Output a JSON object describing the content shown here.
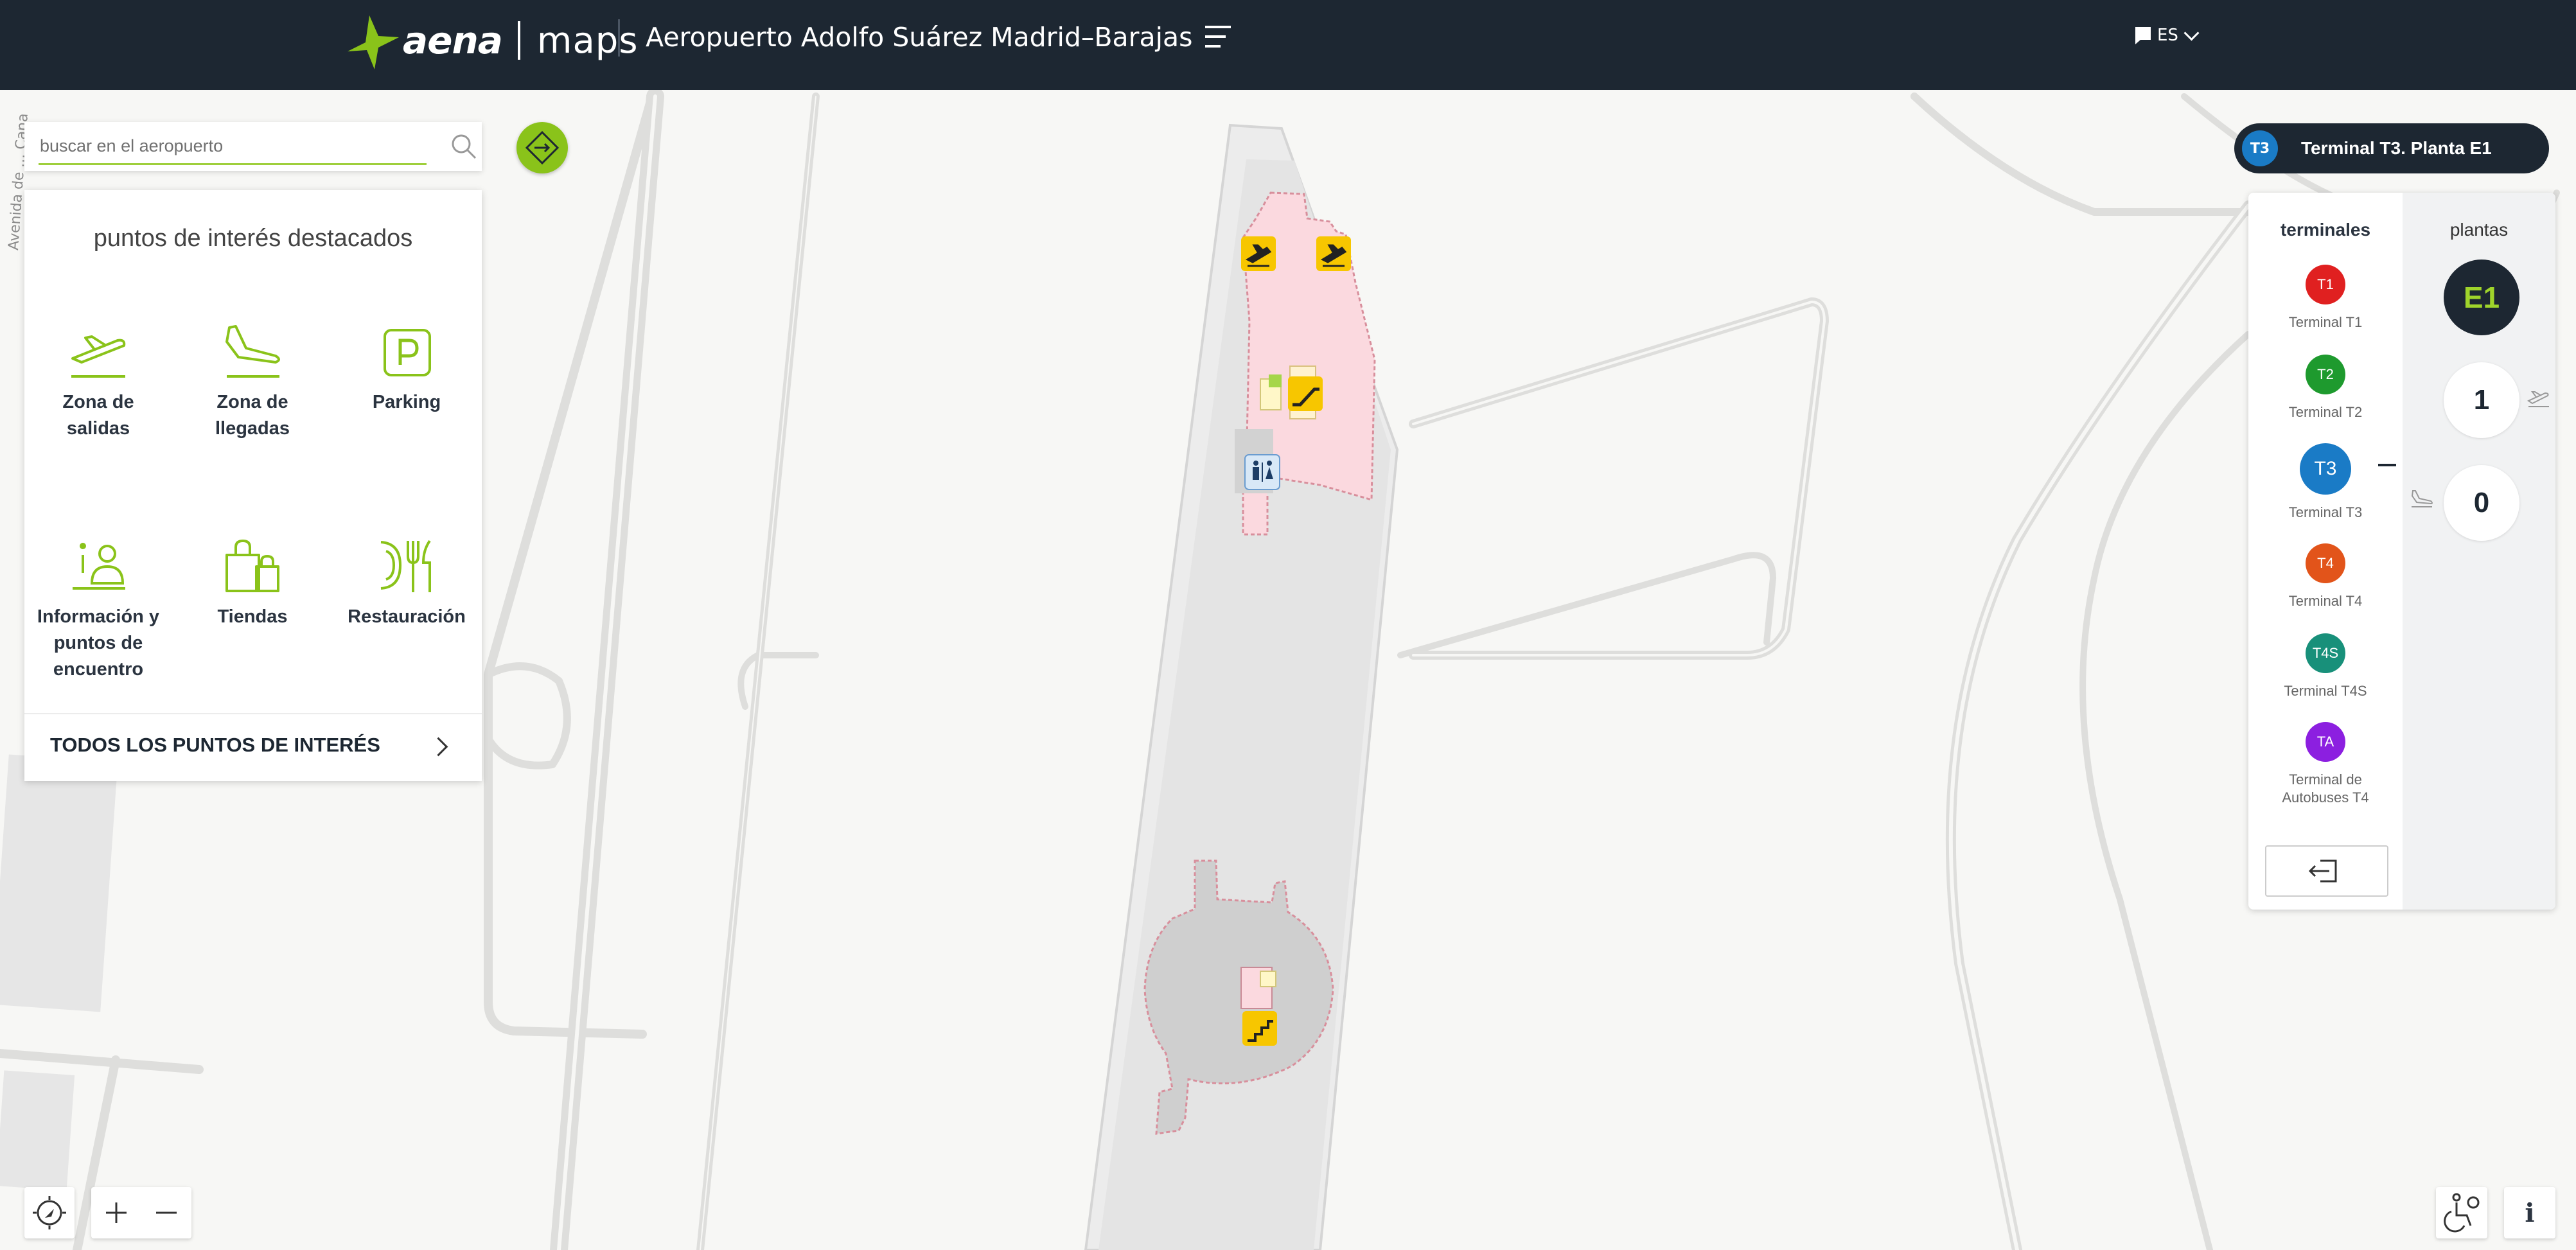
{
  "header": {
    "logo_word": "aena",
    "logo_maps": "maps",
    "airport": "Aeropuerto Adolfo Suárez Madrid–Barajas",
    "language": "ES",
    "menu_icon": "hamburger-menu-icon"
  },
  "map": {
    "street_label": "Avenida de ... Cana",
    "colors": {
      "background": "#f7f7f5",
      "road": "#e2e2e0",
      "terminal": "#e8e8e8",
      "poi_area": "#fbd9df",
      "poi_area_border": "#d88f9c"
    },
    "markers": [
      {
        "name": "departures-marker",
        "icon": "plane-takeoff-icon"
      },
      {
        "name": "departures-marker-2",
        "icon": "plane-takeoff-icon"
      },
      {
        "name": "escalator-marker",
        "icon": "escalator-icon"
      },
      {
        "name": "restroom-marker",
        "icon": "restroom-icon"
      },
      {
        "name": "stairs-marker",
        "icon": "stairs-icon"
      }
    ]
  },
  "search": {
    "placeholder": "buscar en el aeropuerto",
    "value": ""
  },
  "poi_panel": {
    "title": "puntos de interés destacados",
    "items": [
      {
        "line1": "Zona de",
        "line2": "salidas",
        "line3": "",
        "icon": "departures-icon"
      },
      {
        "line1": "Zona de",
        "line2": "llegadas",
        "line3": "",
        "icon": "arrivals-icon"
      },
      {
        "line1": "Parking",
        "line2": "",
        "line3": "",
        "icon": "parking-icon"
      },
      {
        "line1": "Información y",
        "line2": "puntos de",
        "line3": "encuentro",
        "icon": "information-icon"
      },
      {
        "line1": "Tiendas",
        "line2": "",
        "line3": "",
        "icon": "shopping-icon"
      },
      {
        "line1": "Restauración",
        "line2": "",
        "line3": "",
        "icon": "restaurant-icon"
      }
    ],
    "all_label": "TODOS LOS PUNTOS DE INTERÉS",
    "accent": "#8ac31a"
  },
  "terminal_selector": {
    "badge": "T3",
    "label": "Terminal T3. Planta E1",
    "terminals_header": "terminales",
    "floors_header": "plantas",
    "terminals": [
      {
        "code": "T1",
        "name": "Terminal T1",
        "name2": "",
        "color": "#e02020"
      },
      {
        "code": "T2",
        "name": "Terminal T2",
        "name2": "",
        "color": "#1e9a2e"
      },
      {
        "code": "T3",
        "name": "Terminal T3",
        "name2": "",
        "color": "#1a7bc6"
      },
      {
        "code": "T4",
        "name": "Terminal T4",
        "name2": "",
        "color": "#e2541a"
      },
      {
        "code": "T4S",
        "name": "Terminal T4S",
        "name2": "",
        "color": "#18907a"
      },
      {
        "code": "TA",
        "name": "Terminal de",
        "name2": "Autobuses T4",
        "color": "#8c1fe0"
      }
    ],
    "active_terminal": "T3",
    "floors": [
      {
        "label": "E1",
        "active": true,
        "icon": ""
      },
      {
        "label": "1",
        "active": false,
        "icon": "departures-icon"
      },
      {
        "label": "0",
        "active": false,
        "icon": "arrivals-icon"
      }
    ]
  },
  "controls": {
    "compass_icon": "compass-icon",
    "zoom_in_icon": "plus-icon",
    "zoom_out_icon": "minus-icon",
    "accessibility_icon": "accessibility-icon",
    "info_label": "i"
  }
}
